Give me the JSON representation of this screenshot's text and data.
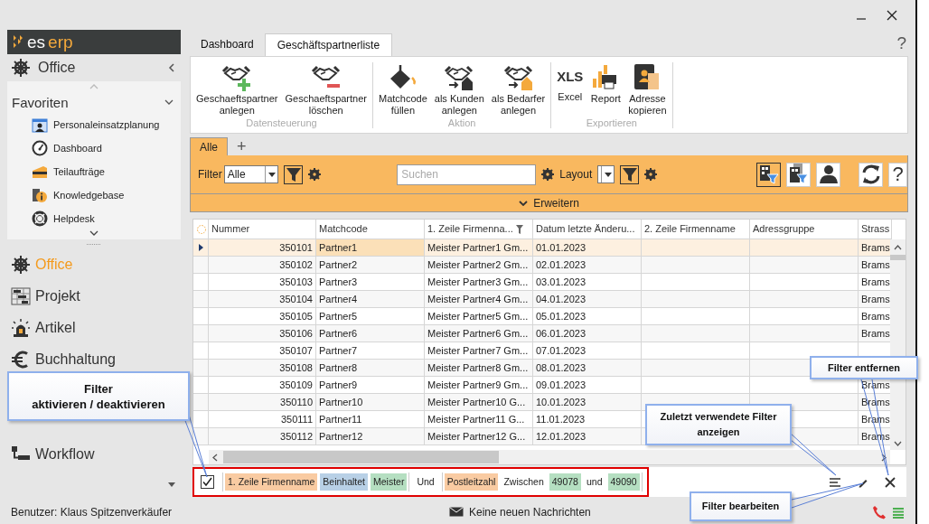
{
  "window": {
    "help": "?"
  },
  "sidebar": {
    "logo_prefix": "es",
    "logo_suffix": "erp",
    "module": "Office",
    "favorites_title": "Favoriten",
    "favorites": [
      {
        "label": "Personaleinsatzplanung",
        "kind": "calendar"
      },
      {
        "label": "Dashboard",
        "kind": "gauge"
      },
      {
        "label": "Teilaufträge",
        "kind": "stack"
      },
      {
        "label": "Knowledgebase",
        "kind": "info"
      },
      {
        "label": "Helpdesk",
        "kind": "lifebuoy"
      }
    ],
    "modules": [
      {
        "label": "Office",
        "kind": "wheel",
        "selected": true
      },
      {
        "label": "Projekt",
        "kind": "gantt",
        "selected": false
      },
      {
        "label": "Artikel",
        "kind": "beacon",
        "selected": false
      },
      {
        "label": "Buchhaltung",
        "kind": "euro",
        "selected": false
      },
      {
        "label": "Workflow",
        "kind": "flow",
        "selected": false
      }
    ]
  },
  "tabs": [
    {
      "label": "Dashboard",
      "selected": false
    },
    {
      "label": "Geschäftspartnerliste",
      "selected": true
    }
  ],
  "ribbon": {
    "groups": [
      {
        "title": "Datensteuerung",
        "buttons": [
          {
            "label": "Geschaeftspartner\nanlegen",
            "kind": "partner-add"
          },
          {
            "label": "Geschaeftspartner\nlöschen",
            "kind": "partner-remove"
          }
        ]
      },
      {
        "title": "Aktion",
        "buttons": [
          {
            "label": "Matchcode\nfüllen",
            "kind": "bucket"
          },
          {
            "label": "als Kunden\nanlegen",
            "kind": "partner-house"
          },
          {
            "label": "als Bedarfer\nanlegen",
            "kind": "partner-house-orange"
          }
        ]
      },
      {
        "title": "Exportieren",
        "buttons": [
          {
            "label": "Excel",
            "kind": "xls",
            "icon_text": "XLS"
          },
          {
            "label": "Report",
            "kind": "report"
          },
          {
            "label": "Adresse\nkopieren",
            "kind": "copy-address"
          }
        ]
      }
    ]
  },
  "filter_panel": {
    "view_tabs": [
      {
        "label": "Alle",
        "selected": true
      }
    ],
    "add_tab": "+",
    "filter_label": "Filter",
    "filter_value": "Alle",
    "search_placeholder": "Suchen",
    "layout_label": "Layout",
    "tools": [
      {
        "kind": "company-filter",
        "selected": true
      },
      {
        "kind": "companies-filter",
        "selected": false
      },
      {
        "kind": "person",
        "selected": false
      },
      {
        "kind": "refresh",
        "selected": false
      },
      {
        "kind": "help",
        "label": "?",
        "selected": false
      }
    ],
    "expand": "Erweitern"
  },
  "table": {
    "columns": [
      {
        "label": "Nummer",
        "filtered": false
      },
      {
        "label": "Matchcode",
        "filtered": false
      },
      {
        "label": "1. Zeile Firmenna...",
        "filtered": true
      },
      {
        "label": "Datum letzte Änderu...",
        "filtered": false
      },
      {
        "label": "2. Zeile Firmenname",
        "filtered": false
      },
      {
        "label": "Adressgruppe",
        "filtered": false
      },
      {
        "label": "Strass",
        "filtered": false
      }
    ],
    "rows": [
      {
        "selected": true,
        "cells": [
          "350101",
          "Partner1",
          "Meister Partner1 Gm...",
          "01.01.2023",
          null,
          null,
          "Brams"
        ]
      },
      {
        "selected": false,
        "cells": [
          "350102",
          "Partner2",
          "Meister Partner2 Gm...",
          "02.01.2023",
          null,
          null,
          "Brams"
        ]
      },
      {
        "selected": false,
        "cells": [
          "350103",
          "Partner3",
          "Meister Partner3 Gm...",
          "03.01.2023",
          null,
          null,
          "Brams"
        ]
      },
      {
        "selected": false,
        "cells": [
          "350104",
          "Partner4",
          "Meister Partner4 Gm...",
          "04.01.2023",
          null,
          null,
          "Brams"
        ]
      },
      {
        "selected": false,
        "cells": [
          "350105",
          "Partner5",
          "Meister Partner5 Gm...",
          "05.01.2023",
          null,
          null,
          "Brams"
        ]
      },
      {
        "selected": false,
        "cells": [
          "350106",
          "Partner6",
          "Meister Partner6 Gm...",
          "06.01.2023",
          null,
          null,
          "Brams"
        ]
      },
      {
        "selected": false,
        "cells": [
          "350107",
          "Partner7",
          "Meister Partner7 Gm...",
          "07.01.2023",
          null,
          null,
          null
        ]
      },
      {
        "selected": false,
        "cells": [
          "350108",
          "Partner8",
          "Meister Partner8 Gm...",
          "08.01.2023",
          null,
          null,
          null
        ]
      },
      {
        "selected": false,
        "cells": [
          "350109",
          "Partner9",
          "Meister Partner9 Gm...",
          "09.01.2023",
          null,
          null,
          "Brams"
        ]
      },
      {
        "selected": false,
        "cells": [
          "350110",
          "Partner10",
          "Meister Partner10 G...",
          "10.01.2023",
          null,
          null,
          "Brams"
        ]
      },
      {
        "selected": false,
        "cells": [
          "350111",
          "Partner11",
          "Meister Partner11 G...",
          "11.01.2023",
          null,
          null,
          "Brams"
        ]
      },
      {
        "selected": false,
        "cells": [
          "350112",
          "Partner12",
          "Meister Partner12 G...",
          "12.01.2023",
          null,
          null,
          "Brams"
        ]
      }
    ]
  },
  "filter_bar": {
    "checked": true,
    "items": [
      {
        "kind": "group",
        "tokens": [
          {
            "kind": "field",
            "text": "1. Zeile Firmenname"
          },
          {
            "kind": "operator",
            "text": "Beinhaltet"
          },
          {
            "kind": "value",
            "text": "Meister"
          }
        ]
      },
      {
        "kind": "word",
        "text": "Und"
      },
      {
        "kind": "group",
        "tokens": [
          {
            "kind": "field",
            "text": "Postleitzahl"
          },
          {
            "kind": "word",
            "text": "Zwischen"
          },
          {
            "kind": "value",
            "text": "49078"
          },
          {
            "kind": "word",
            "text": "und"
          },
          {
            "kind": "value",
            "text": "49090"
          }
        ]
      }
    ]
  },
  "callouts": [
    {
      "text": "Filter\naktivieren / deaktivieren"
    },
    {
      "text": "Zuletzt verwendete Filter\nanzeigen"
    },
    {
      "text": "Filter entfernen"
    },
    {
      "text": "Filter bearbeiten"
    }
  ],
  "status_bar": {
    "user": "Benutzer: Klaus Spitzenverkäufer",
    "messages": "Keine neuen Nachrichten"
  }
}
